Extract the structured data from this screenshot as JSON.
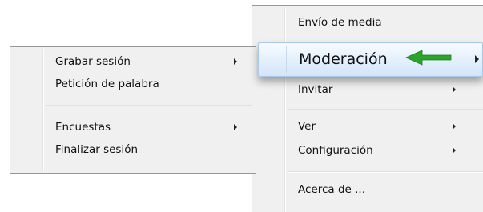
{
  "left_menu": {
    "items": [
      {
        "label": "Grabar sesión",
        "has_submenu": true
      },
      {
        "label": "Petición de palabra",
        "has_submenu": false
      },
      {
        "label": "Encuestas",
        "has_submenu": true
      },
      {
        "label": "Finalizar sesión",
        "has_submenu": false
      }
    ]
  },
  "right_menu": {
    "items": [
      {
        "label": "Envío de media",
        "has_submenu": false
      },
      {
        "label": "Moderación",
        "has_submenu": true,
        "highlighted": true
      },
      {
        "label": "Invitar",
        "has_submenu": true
      },
      {
        "label": "Ver",
        "has_submenu": true
      },
      {
        "label": "Configuración",
        "has_submenu": true
      },
      {
        "label": "Acerca de ...",
        "has_submenu": false
      }
    ]
  },
  "colors": {
    "menu_background": "#f0f0f0",
    "menu_border": "#979797",
    "highlight_background": "#e3effc",
    "highlight_border": "#a9c7e6",
    "pointer_arrow": "#2aa52a"
  },
  "icons": {
    "submenu_arrow": "chevron-right-icon",
    "pointer": "green-arrow-icon"
  }
}
